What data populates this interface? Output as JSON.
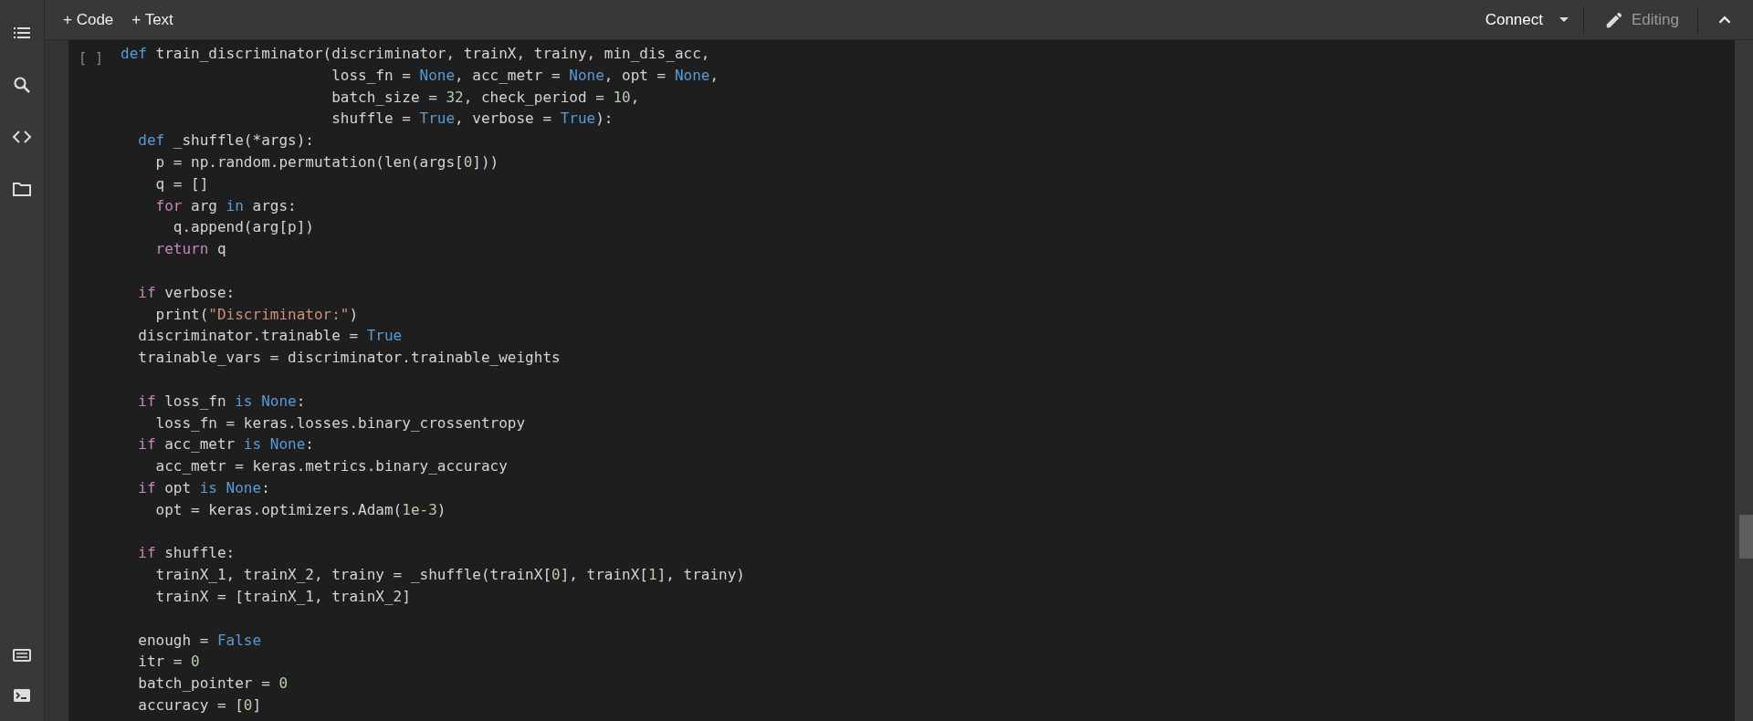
{
  "toolbar": {
    "add_buttons": [
      {
        "icon": "+",
        "label": "Code"
      },
      {
        "icon": "+",
        "label": "Text"
      }
    ],
    "connect": "Connect",
    "mode": "Editing"
  },
  "cell": {
    "run_indicator": "[ ]",
    "lines": [
      {
        "kind": "code",
        "tokens": [
          {
            "kind": "keyword",
            "text": "def"
          },
          {
            "kind": "text",
            "text": " train_discriminator(discriminator, trainX, trainy, min_dis_acc,"
          }
        ]
      },
      {
        "kind": "code",
        "tokens": [
          {
            "kind": "text",
            "text": "                        loss_fn = "
          },
          {
            "kind": "keyword",
            "text": "None"
          },
          {
            "kind": "text",
            "text": ", acc_metr = "
          },
          {
            "kind": "keyword",
            "text": "None"
          },
          {
            "kind": "text",
            "text": ", opt = "
          },
          {
            "kind": "keyword",
            "text": "None"
          },
          {
            "kind": "text",
            "text": ","
          }
        ]
      },
      {
        "kind": "code",
        "tokens": [
          {
            "kind": "text",
            "text": "                        batch_size = "
          },
          {
            "kind": "number",
            "text": "32"
          },
          {
            "kind": "text",
            "text": ", check_period = "
          },
          {
            "kind": "number",
            "text": "10"
          },
          {
            "kind": "text",
            "text": ","
          }
        ]
      },
      {
        "kind": "code",
        "tokens": [
          {
            "kind": "text",
            "text": "                        shuffle = "
          },
          {
            "kind": "keyword",
            "text": "True"
          },
          {
            "kind": "text",
            "text": ", verbose = "
          },
          {
            "kind": "keyword",
            "text": "True"
          },
          {
            "kind": "text",
            "text": "):"
          }
        ]
      },
      {
        "kind": "code",
        "tokens": [
          {
            "kind": "keyword",
            "text": "  def"
          },
          {
            "kind": "text",
            "text": " _shuffle(*args):"
          }
        ]
      },
      {
        "kind": "code",
        "tokens": [
          {
            "kind": "text",
            "text": "    p = np.random.permutation(len(args["
          },
          {
            "kind": "number",
            "text": "0"
          },
          {
            "kind": "text",
            "text": "]))"
          }
        ]
      },
      {
        "kind": "code",
        "tokens": [
          {
            "kind": "text",
            "text": "    q = []"
          }
        ]
      },
      {
        "kind": "code",
        "tokens": [
          {
            "kind": "control",
            "text": "    for"
          },
          {
            "kind": "text",
            "text": " arg "
          },
          {
            "kind": "keyword",
            "text": "in"
          },
          {
            "kind": "text",
            "text": " args:"
          }
        ]
      },
      {
        "kind": "code",
        "tokens": [
          {
            "kind": "text",
            "text": "      q.append(arg[p])"
          }
        ]
      },
      {
        "kind": "code",
        "tokens": [
          {
            "kind": "control",
            "text": "    return"
          },
          {
            "kind": "text",
            "text": " q"
          }
        ]
      },
      {
        "kind": "blank"
      },
      {
        "kind": "code",
        "tokens": [
          {
            "kind": "control",
            "text": "  if"
          },
          {
            "kind": "text",
            "text": " verbose:"
          }
        ]
      },
      {
        "kind": "code",
        "tokens": [
          {
            "kind": "text",
            "text": "    print("
          },
          {
            "kind": "string",
            "text": "\"Discriminator:\""
          },
          {
            "kind": "text",
            "text": ")"
          }
        ]
      },
      {
        "kind": "code",
        "tokens": [
          {
            "kind": "text",
            "text": "  discriminator.trainable = "
          },
          {
            "kind": "keyword",
            "text": "True"
          }
        ]
      },
      {
        "kind": "code",
        "tokens": [
          {
            "kind": "text",
            "text": "  trainable_vars = discriminator.trainable_weights"
          }
        ]
      },
      {
        "kind": "blank"
      },
      {
        "kind": "code",
        "tokens": [
          {
            "kind": "control",
            "text": "  if"
          },
          {
            "kind": "text",
            "text": " loss_fn "
          },
          {
            "kind": "keyword",
            "text": "is None"
          },
          {
            "kind": "text",
            "text": ":"
          }
        ]
      },
      {
        "kind": "code",
        "tokens": [
          {
            "kind": "text",
            "text": "    loss_fn = keras.losses.binary_crossentropy"
          }
        ]
      },
      {
        "kind": "code",
        "tokens": [
          {
            "kind": "control",
            "text": "  if"
          },
          {
            "kind": "text",
            "text": " acc_metr "
          },
          {
            "kind": "keyword",
            "text": "is None"
          },
          {
            "kind": "text",
            "text": ":"
          }
        ]
      },
      {
        "kind": "code",
        "tokens": [
          {
            "kind": "text",
            "text": "    acc_metr = keras.metrics.binary_accuracy"
          }
        ]
      },
      {
        "kind": "code",
        "tokens": [
          {
            "kind": "control",
            "text": "  if"
          },
          {
            "kind": "text",
            "text": " opt "
          },
          {
            "kind": "keyword",
            "text": "is None"
          },
          {
            "kind": "text",
            "text": ":"
          }
        ]
      },
      {
        "kind": "code",
        "tokens": [
          {
            "kind": "text",
            "text": "    opt = keras.optimizers.Adam("
          },
          {
            "kind": "number",
            "text": "1e-3"
          },
          {
            "kind": "text",
            "text": ")"
          }
        ]
      },
      {
        "kind": "blank"
      },
      {
        "kind": "code",
        "tokens": [
          {
            "kind": "control",
            "text": "  if"
          },
          {
            "kind": "text",
            "text": " shuffle:"
          }
        ]
      },
      {
        "kind": "code",
        "tokens": [
          {
            "kind": "text",
            "text": "    trainX_1, trainX_2, trainy = _shuffle(trainX["
          },
          {
            "kind": "number",
            "text": "0"
          },
          {
            "kind": "text",
            "text": "], trainX["
          },
          {
            "kind": "number",
            "text": "1"
          },
          {
            "kind": "text",
            "text": "], trainy)"
          }
        ]
      },
      {
        "kind": "code",
        "tokens": [
          {
            "kind": "text",
            "text": "    trainX = [trainX_1, trainX_2]"
          }
        ]
      },
      {
        "kind": "blank"
      },
      {
        "kind": "code",
        "tokens": [
          {
            "kind": "text",
            "text": "  enough = "
          },
          {
            "kind": "keyword",
            "text": "False"
          }
        ]
      },
      {
        "kind": "code",
        "tokens": [
          {
            "kind": "text",
            "text": "  itr = "
          },
          {
            "kind": "number",
            "text": "0"
          }
        ]
      },
      {
        "kind": "code",
        "tokens": [
          {
            "kind": "text",
            "text": "  batch_pointer = "
          },
          {
            "kind": "number",
            "text": "0"
          }
        ]
      },
      {
        "kind": "code",
        "tokens": [
          {
            "kind": "text",
            "text": "  accuracy = ["
          },
          {
            "kind": "number",
            "text": "0"
          },
          {
            "kind": "text",
            "text": "]"
          }
        ]
      }
    ]
  }
}
